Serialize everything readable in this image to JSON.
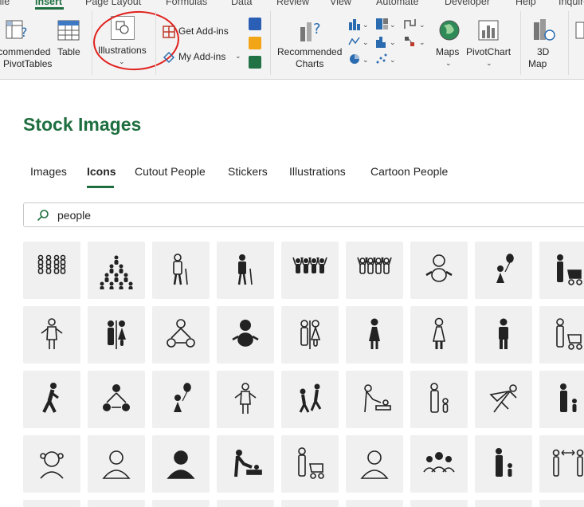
{
  "ribbon": {
    "tabs": [
      "File",
      "Insert",
      "Page Layout",
      "Formulas",
      "Data",
      "Review",
      "View",
      "Automate",
      "Developer",
      "Help",
      "Inquire"
    ],
    "buttons": {
      "recommended_pivot_line1": "Recommended",
      "recommended_pivot_line2": "PivotTables",
      "table": "Table",
      "illustrations": "Illustrations",
      "get_addins": "Get Add-ins",
      "my_addins": "My Add-ins",
      "recommended_charts_line1": "Recommended",
      "recommended_charts_line2": "Charts",
      "maps": "Maps",
      "pivotchart": "PivotChart",
      "map3d_line1": "3D",
      "map3d_line2": "Map"
    }
  },
  "pane": {
    "title": "Stock Images",
    "tabs": [
      "Images",
      "Icons",
      "Cutout People",
      "Stickers",
      "Illustrations",
      "Cartoon People"
    ],
    "active_tab": "Icons",
    "search": {
      "value": "people"
    }
  },
  "icons": [
    [
      "people-group-outline-icon",
      "people-crowd-pyramid-icon",
      "elderly-person-outline-icon",
      "elderly-person-icon",
      "people-cheering-icon",
      "people-cheering-outline-icon",
      "baby-outline-icon",
      "child-balloon-icon",
      "parent-stroller-icon"
    ],
    [
      "person-shrug-outline-icon",
      "restroom-icon",
      "network-people-outline-icon",
      "baby-crawling-icon",
      "restroom-outline-icon",
      "woman-icon",
      "woman-outline-icon",
      "man-icon",
      "parent-stroller-outline-icon"
    ],
    [
      "person-walking-icon",
      "network-people-icon",
      "child-balloon-filled-icon",
      "person-shrug-outline-2-icon",
      "people-dancing-icon",
      "diaper-change-outline-icon",
      "parent-child-outline-icon",
      "superhero-outline-icon",
      "parent-carrying-child-icon"
    ],
    [
      "girl-outline-icon",
      "woman-bust-outline-icon",
      "man-bust-icon",
      "diaper-change-icon",
      "parent-stroller-outline-2-icon",
      "user-outline-icon",
      "people-group-users-icon",
      "parent-child-walking-icon",
      "social-distance-outline-icon"
    ]
  ],
  "colors": {
    "accent": "#1e6e3f",
    "annotation": "#e0201d",
    "tile_bg": "#f0f0f0"
  }
}
